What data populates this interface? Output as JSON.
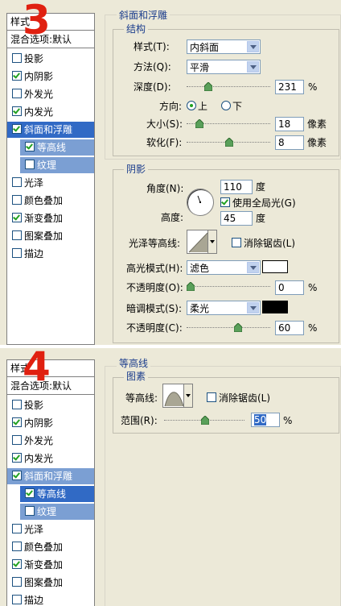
{
  "panel3": {
    "step_number": "3",
    "sidebar": {
      "header": "样式",
      "blend_default": "混合选项:默认",
      "items": [
        {
          "label": "投影",
          "checked": false
        },
        {
          "label": "内阴影",
          "checked": true
        },
        {
          "label": "外发光",
          "checked": false
        },
        {
          "label": "内发光",
          "checked": true
        },
        {
          "label": "斜面和浮雕",
          "checked": true
        },
        {
          "label": "等高线",
          "checked": true
        },
        {
          "label": "纹理",
          "checked": false
        },
        {
          "label": "光泽",
          "checked": false
        },
        {
          "label": "颜色叠加",
          "checked": false
        },
        {
          "label": "渐变叠加",
          "checked": true
        },
        {
          "label": "图案叠加",
          "checked": false
        },
        {
          "label": "描边",
          "checked": false
        }
      ]
    },
    "bevel": {
      "title": "斜面和浮雕",
      "structure_title": "结构",
      "style_label": "样式(T):",
      "style_value": "内斜面",
      "technique_label": "方法(Q):",
      "technique_value": "平滑",
      "depth_label": "深度(D):",
      "depth_value": "231",
      "depth_unit": "%",
      "direction_label": "方向:",
      "direction_up": "上",
      "direction_down": "下",
      "size_label": "大小(S):",
      "size_value": "18",
      "size_unit": "像素",
      "soften_label": "软化(F):",
      "soften_value": "8",
      "soften_unit": "像素"
    },
    "shading": {
      "title": "阴影",
      "angle_label": "角度(N):",
      "angle_value": "110",
      "angle_unit": "度",
      "global_light_label": "使用全局光(G)",
      "altitude_label": "高度:",
      "altitude_value": "45",
      "altitude_unit": "度",
      "gloss_contour_label": "光泽等高线:",
      "antialias_label": "消除锯齿(L)",
      "highlight_mode_label": "高光模式(H):",
      "highlight_mode_value": "滤色",
      "highlight_color": "#ffffff",
      "highlight_opacity_label": "不透明度(O):",
      "highlight_opacity_value": "0",
      "highlight_opacity_unit": "%",
      "shadow_mode_label": "暗调模式(S):",
      "shadow_mode_value": "柔光",
      "shadow_color": "#000000",
      "shadow_opacity_label": "不透明度(C):",
      "shadow_opacity_value": "60",
      "shadow_opacity_unit": "%"
    }
  },
  "panel4": {
    "step_number": "4",
    "sidebar": {
      "header": "样式",
      "blend_default": "混合选项:默认",
      "items": [
        {
          "label": "投影",
          "checked": false
        },
        {
          "label": "内阴影",
          "checked": true
        },
        {
          "label": "外发光",
          "checked": false
        },
        {
          "label": "内发光",
          "checked": true
        },
        {
          "label": "斜面和浮雕",
          "checked": true
        },
        {
          "label": "等高线",
          "checked": true
        },
        {
          "label": "纹理",
          "checked": false
        },
        {
          "label": "光泽",
          "checked": false
        },
        {
          "label": "颜色叠加",
          "checked": false
        },
        {
          "label": "渐变叠加",
          "checked": true
        },
        {
          "label": "图案叠加",
          "checked": false
        },
        {
          "label": "描边",
          "checked": false
        }
      ]
    },
    "contour": {
      "title": "等高线",
      "elements_title": "图素",
      "contour_label": "等高线:",
      "antialias_label": "消除锯齿(L)",
      "range_label": "范围(R):",
      "range_value": "50",
      "range_unit": "%"
    }
  },
  "colors": {
    "selection": "#316ac5",
    "subselection": "#7b9fd3",
    "step_number": "#e02010",
    "legend_text": "#1a3c8c"
  }
}
